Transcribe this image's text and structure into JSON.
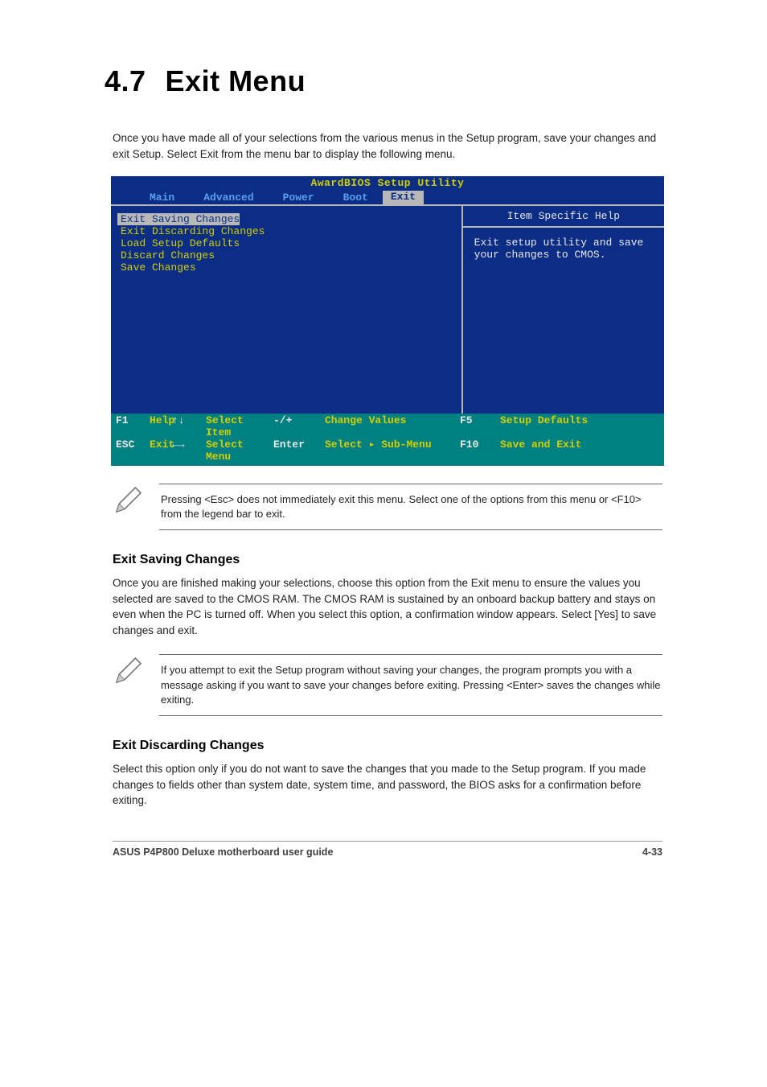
{
  "heading": {
    "num": "4.7",
    "title": "Exit Menu"
  },
  "intro": "Once you have made all of your selections from the various menus in the Setup program, save your changes and exit Setup. Select Exit from the menu bar to display the following menu.",
  "bios": {
    "title": "AwardBIOS Setup Utility",
    "tabs": [
      "Main",
      "Advanced",
      "Power",
      "Boot",
      "Exit"
    ],
    "activeTab": "Exit",
    "menu": {
      "items": [
        "Exit Saving Changes",
        "Exit Discarding Changes",
        "Load Setup Defaults",
        "Discard Changes",
        "Save Changes"
      ],
      "selectedIndex": 0
    },
    "help": {
      "title": "Item Specific Help",
      "text": "Exit setup utility and save your changes to CMOS."
    },
    "footer": {
      "row1": [
        {
          "k": "F1",
          "v": "Help"
        },
        {
          "k": "↑↓",
          "v": "Select Item"
        },
        {
          "k": "-/+",
          "v": "Change Values"
        },
        {
          "k": "F5",
          "v": "Setup Defaults"
        }
      ],
      "row2": [
        {
          "k": "ESC",
          "v": "Exit"
        },
        {
          "k": "←→",
          "v": "Select Menu"
        },
        {
          "k": "Enter",
          "v": "Select ▸ Sub-Menu"
        },
        {
          "k": "F10",
          "v": "Save and Exit"
        }
      ]
    }
  },
  "note1": "Pressing <Esc> does not immediately exit this menu. Select one of the options from this menu or <F10> from the legend bar to exit.",
  "section1": {
    "title": "Exit Saving Changes",
    "body": "Once you are finished making your selections, choose this option from the Exit menu to ensure the values you selected are saved to the CMOS RAM. The CMOS RAM is sustained by an onboard backup battery and stays on even when the PC is turned off. When you select this option, a confirmation window appears. Select [Yes] to save changes and exit."
  },
  "note2": "If you attempt to exit the Setup program without saving your changes, the program prompts you with a message asking if you want to save your changes before exiting. Pressing <Enter> saves the changes while exiting.",
  "section2": {
    "title": "Exit Discarding Changes",
    "body": "Select this option only if you do not want to save the changes that you made to the Setup program. If you made changes to fields other than system date, system time, and password, the BIOS asks for a confirmation before exiting."
  },
  "footer": {
    "left": "ASUS P4P800 Deluxe motherboard user guide",
    "right": "4-33"
  }
}
